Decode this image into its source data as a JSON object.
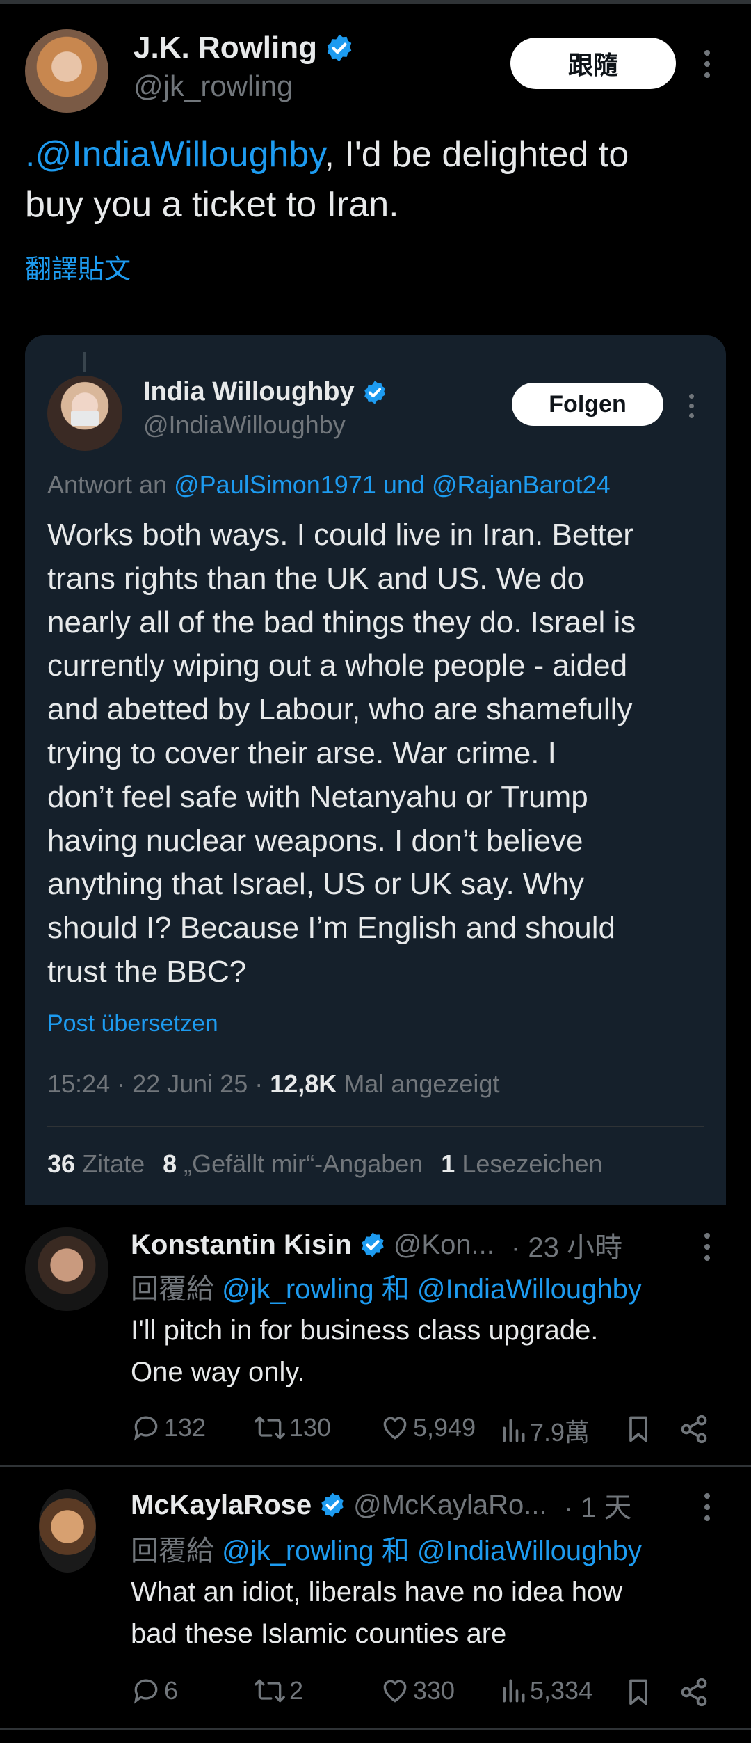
{
  "main_tweet": {
    "name": "J.K. Rowling",
    "handle": "@jk_rowling",
    "follow_label": "跟隨",
    "mention": ".@IndiaWilloughby",
    "text_line1_rest": ", I'd be delighted to",
    "text_line2": "buy you a ticket to Iran.",
    "translate_label": "翻譯貼文"
  },
  "quoted_tweet": {
    "name": "India Willoughby",
    "handle": "@IndiaWilloughby",
    "follow_label": "Folgen",
    "reply_prefix": "Antwort an",
    "reply_user1": "@PaulSimon1971",
    "reply_and": "und",
    "reply_user2": "@RajanBarot24",
    "lines": [
      "Works both ways. I could live in Iran. Better",
      "trans rights than the UK and US. We do",
      "nearly all of the bad things they do. Israel is",
      "currently wiping out a whole people - aided",
      "and abetted by Labour, who are shamefully",
      "trying to cover their arse. War crime.  I",
      "don’t feel safe with Netanyahu or Trump",
      "having nuclear weapons. I don’t believe",
      "anything that Israel, US or UK say. Why",
      "should I? Because I’m English and should",
      "trust the BBC?"
    ],
    "translate_label": "Post übersetzen",
    "timestamp": "15:24 · 22 Juni 25 ·",
    "views_count": "12,8K",
    "views_label": "Mal angezeigt",
    "quotes_count": "36",
    "quotes_label": "Zitate",
    "likes_count": "8",
    "likes_label": "„Gefällt mir“-Angaben",
    "bookmarks_count": "1",
    "bookmarks_label": "Lesezeichen"
  },
  "replies": [
    {
      "name": "Konstantin Kisin",
      "handle": "@Kon...",
      "time": "· 23 小時",
      "reply_prefix": "回覆給",
      "reply_user1": "@jk_rowling",
      "reply_and": "和",
      "reply_user2": "@IndiaWilloughby",
      "line1": "I'll pitch in for business class upgrade.",
      "line2": "One way only.",
      "replies": "132",
      "reposts": "130",
      "likes": "5,949",
      "views": "7.9萬"
    },
    {
      "name": "McKaylaRose",
      "handle": "@McKaylaRo...",
      "time": "· 1 天",
      "reply_prefix": "回覆給",
      "reply_user1": "@jk_rowling",
      "reply_and": "和",
      "reply_user2": "@IndiaWilloughby",
      "line1": "What an idiot, liberals have no idea how",
      "line2": "bad these Islamic counties are",
      "replies": "6",
      "reposts": "2",
      "likes": "330",
      "views": "5,334"
    }
  ],
  "colors": {
    "accent": "#1d9bf0",
    "background": "#000000",
    "card": "#15202b",
    "muted": "#71767b"
  }
}
